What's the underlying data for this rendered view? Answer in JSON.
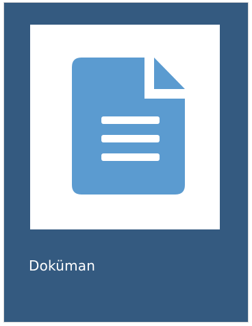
{
  "tile": {
    "label": "Doküman",
    "icon": "document-icon"
  },
  "colors": {
    "tile_background": "#345a80",
    "icon_blue": "#5b9bd0",
    "thumbnail_background": "#ffffff",
    "label_text": "#ffffff"
  }
}
